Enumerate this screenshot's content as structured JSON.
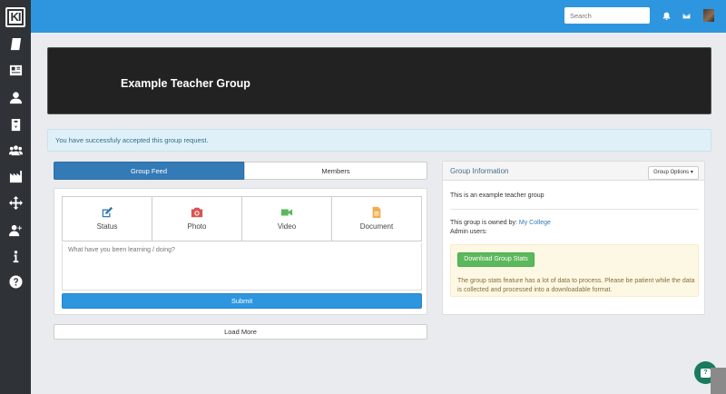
{
  "app": {
    "logo_text": "KI"
  },
  "sidebar": {
    "items": [
      {
        "name": "notebook"
      },
      {
        "name": "news"
      },
      {
        "name": "profile"
      },
      {
        "name": "badge"
      },
      {
        "name": "groups"
      },
      {
        "name": "institution"
      },
      {
        "name": "move"
      },
      {
        "name": "add-user"
      },
      {
        "name": "info"
      },
      {
        "name": "help"
      }
    ]
  },
  "header": {
    "search_placeholder": "Search",
    "icons": [
      "bell-icon",
      "envelope-icon"
    ],
    "accent_color": "#2e95df"
  },
  "banner": {
    "title": "Example Teacher Group"
  },
  "alert": {
    "text": "You have successfuly accepted this group request."
  },
  "feed": {
    "tabs": [
      {
        "label": "Group Feed",
        "active": true
      },
      {
        "label": "Members",
        "active": false
      }
    ],
    "post_types": [
      {
        "label": "Status",
        "icon": "pencil-square-icon",
        "color": "#337ab7"
      },
      {
        "label": "Photo",
        "icon": "camera-icon",
        "color": "#d9534f"
      },
      {
        "label": "Video",
        "icon": "video-camera-icon",
        "color": "#5cb85c"
      },
      {
        "label": "Document",
        "icon": "document-icon",
        "color": "#f0ad4e"
      }
    ],
    "input_placeholder": "What have you been learning / doing?",
    "submit_label": "Submit",
    "load_more_label": "Load More"
  },
  "group_info": {
    "title": "Group Information",
    "options_label": "Group Options ▾",
    "description": "This is an example teacher group",
    "owned_by_label": "This group is owned by:",
    "owner": "My College",
    "admin_label": "Admin users:",
    "download_label": "Download Group Stats",
    "notice": "The group stats feature has a lot of data to process. Please be patient while the data is collected and processed into a downloadable format."
  }
}
